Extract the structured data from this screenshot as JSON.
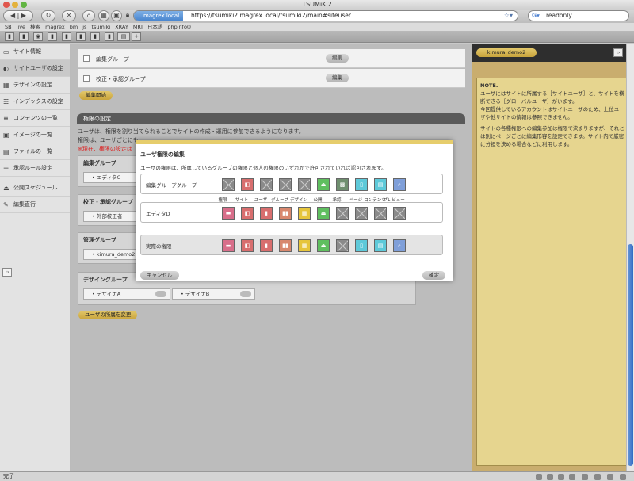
{
  "browser": {
    "window_title": "TSUMiKi2",
    "site_chip": "magrex.local",
    "url": "https://tsumiki2.magrex.local/tsumiki2/main#siteuser",
    "search_value": "readonly",
    "status": "完了"
  },
  "bookmarks": [
    "SB",
    "live",
    "検索",
    "magrex",
    "bm",
    "js",
    "tsumiki",
    "XRAY",
    "MRI",
    "日本語",
    "phpinfo()"
  ],
  "sidebar": {
    "items": [
      {
        "label": "サイト情報",
        "icon": "page-icon"
      },
      {
        "label": "サイトユーザの設定",
        "icon": "user-icon",
        "active": true
      },
      {
        "label": "デザインの設定",
        "icon": "layout-icon"
      },
      {
        "label": "インデックスの設定",
        "icon": "tree-icon"
      },
      {
        "label": "コンテンツの一覧",
        "icon": "list-icon"
      },
      {
        "label": "イメージの一覧",
        "icon": "image-icon"
      },
      {
        "label": "ファイルの一覧",
        "icon": "file-icon"
      },
      {
        "label": "承認ルール設定",
        "icon": "rule-icon"
      },
      {
        "label": "公開スケジュール",
        "icon": "publish-icon"
      },
      {
        "label": "編集直行",
        "icon": "pencil-icon"
      }
    ]
  },
  "main": {
    "group_rows": [
      {
        "label": "編集グループ",
        "button": "編集"
      },
      {
        "label": "校正・承認グループ",
        "button": "編集"
      }
    ],
    "edit_start": "編集開始",
    "section_title": "権限の設定",
    "desc1": "ユーザは、権限を割り当てられることでサイトの作成・運用に参加できるようになります。",
    "desc2": "権限は、ユーザごとにも",
    "warning": "※現在、権限の設定は",
    "groups": [
      {
        "title": "編集グループ",
        "members": [
          "エディタC"
        ]
      },
      {
        "title": "校正・承認グループ",
        "members": [
          "外部校正者"
        ]
      },
      {
        "title": "管理グループ",
        "members": [
          "kimura_demo2"
        ]
      },
      {
        "title": "デザイングループ",
        "members": [
          "デザイナA",
          "デザイナB"
        ]
      }
    ],
    "change_button": "ユーザの所属を変更"
  },
  "modal": {
    "title": "ユーザ権限の編集",
    "description": "ユーザの権限は、所属しているグループの権限と個人の権限のいずれかで許可されていれば認可されます。",
    "columns": [
      "権限",
      "サイト",
      "ユーザ",
      "グループ",
      "デザイン",
      "公開",
      "承認",
      "ページ",
      "コンテンツ",
      "プレビュー"
    ],
    "rows": [
      {
        "label": "編集グループグループ",
        "perms": [
          false,
          true,
          false,
          false,
          false,
          true,
          true,
          true,
          true,
          true
        ]
      },
      {
        "label": "エディタD",
        "perms": [
          true,
          true,
          true,
          true,
          true,
          true,
          false,
          false,
          false,
          false
        ]
      },
      {
        "label": "実際の権限",
        "perms": [
          true,
          true,
          true,
          true,
          true,
          true,
          false,
          true,
          true,
          true
        ]
      }
    ],
    "cancel": "キャンセル",
    "ok": "確定"
  },
  "right": {
    "user": "kimura_demo2",
    "note_title": "NOTE.",
    "note_p1": "ユーザにはサイトに所属する［サイトユーザ］と、サイトを横断できる［グローバルユーザ］がいます。",
    "note_p2": "今回提供しているアカウントはサイトユーザのため、上位ユーザや他サイトの情報は参照できません。",
    "note_p3": "サイトの各種権限への編集参加は権限で決まりますが、それとは別にページごとに編集形容を設定できます。サイト内で厳密に分担を決める場合などに利用します。"
  },
  "colors": {
    "accent": "#c9a43c",
    "modal_top": "#e6cd6c"
  }
}
